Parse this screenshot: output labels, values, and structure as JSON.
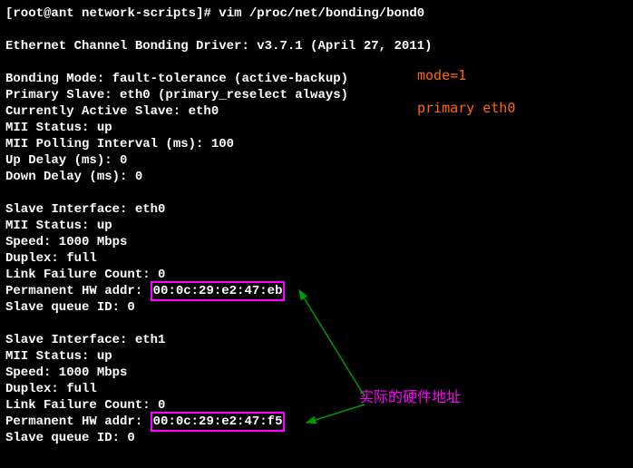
{
  "prompt": {
    "user": "root",
    "host": "ant",
    "cwd": "network-scripts",
    "command": "vim /proc/net/bonding/bond0"
  },
  "output": {
    "driver": "Ethernet Channel Bonding Driver: v3.7.1 (April 27, 2011)",
    "bonding_mode": "Bonding Mode: fault-tolerance (active-backup)",
    "primary_slave": "Primary Slave: eth0 (primary_reselect always)",
    "active_slave": "Currently Active Slave: eth0",
    "mii_status": "MII Status: up",
    "mii_polling": "MII Polling Interval (ms): 100",
    "up_delay": "Up Delay (ms): 0",
    "down_delay": "Down Delay (ms): 0",
    "slave1": {
      "interface": "Slave Interface: eth0",
      "mii": "MII Status: up",
      "speed": "Speed: 1000 Mbps",
      "duplex": "Duplex: full",
      "link_fail": "Link Failure Count: 0",
      "hw_label": "Permanent HW addr: ",
      "hw_addr": "00:0c:29:e2:47:eb",
      "queue": "Slave queue ID: 0"
    },
    "slave2": {
      "interface": "Slave Interface: eth1",
      "mii": "MII Status: up",
      "speed": "Speed: 1000 Mbps",
      "duplex": "Duplex: full",
      "link_fail": "Link Failure Count: 0",
      "hw_label": "Permanent HW addr: ",
      "hw_addr": "00:0c:29:e2:47:f5",
      "queue": "Slave queue ID: 0"
    }
  },
  "annotations": {
    "mode": "mode=1",
    "primary": "primary eth0",
    "hw_label": "实际的硬件地址"
  }
}
